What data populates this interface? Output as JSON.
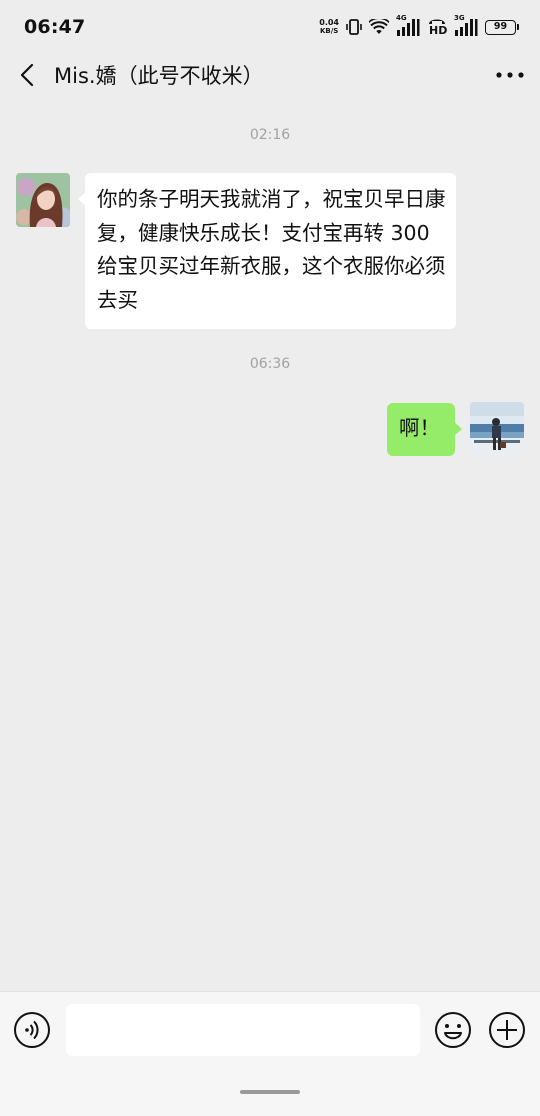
{
  "status_bar": {
    "time": "06:47",
    "net_speed_value": "0.04",
    "net_speed_unit": "KB/S",
    "sim1_label": "4G",
    "sim2_label": "3G",
    "hd_label": "HD",
    "battery": "99"
  },
  "header": {
    "title": "Mis.嬌（此号不收米）",
    "back_icon": "chevron-left-icon",
    "more_icon": "more-dots-icon"
  },
  "messages": [
    {
      "type": "timestamp",
      "text": "02:16"
    },
    {
      "type": "incoming",
      "text": "你的条子明天我就消了，祝宝贝早日康复，健康快乐成长！支付宝再转 300 给宝贝买过年新衣服，这个衣服你必须去买"
    },
    {
      "type": "timestamp",
      "text": "06:36"
    },
    {
      "type": "outgoing",
      "text": "啊！"
    }
  ],
  "input_bar": {
    "voice_icon": "voice-icon",
    "emoji_icon": "emoji-icon",
    "plus_icon": "plus-icon",
    "input_value": ""
  },
  "colors": {
    "background": "#ededed",
    "outgoing_bubble": "#95ec69",
    "incoming_bubble": "#ffffff",
    "timestamp_text": "#a2a2a2"
  }
}
